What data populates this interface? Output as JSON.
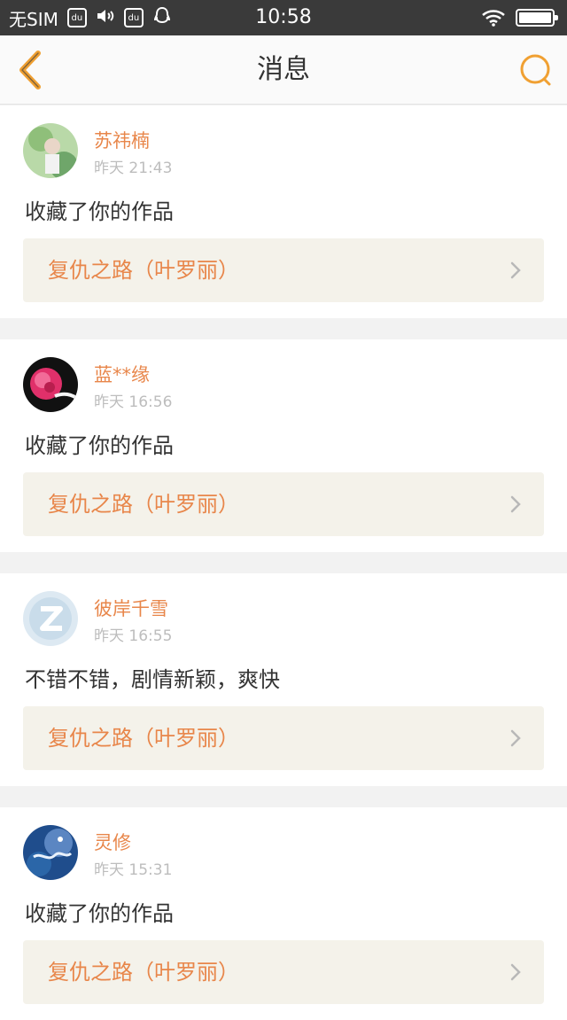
{
  "status_bar": {
    "carrier": "无SIM",
    "time": "10:58"
  },
  "nav": {
    "title": "消息",
    "accent_color": "#f0a032"
  },
  "messages": [
    {
      "username": "苏祎楠",
      "time": "昨天 21:43",
      "text": "收藏了你的作品",
      "work_title": "复仇之路（叶罗丽）"
    },
    {
      "username": "蓝**缘",
      "time": "昨天 16:56",
      "text": "收藏了你的作品",
      "work_title": "复仇之路（叶罗丽）"
    },
    {
      "username": "彼岸千雪",
      "time": "昨天 16:55",
      "text": "不错不错，剧情新颖，爽快",
      "work_title": "复仇之路（叶罗丽）"
    },
    {
      "username": "灵修",
      "time": "昨天 15:31",
      "text": "收藏了你的作品",
      "work_title": "复仇之路（叶罗丽）"
    }
  ]
}
